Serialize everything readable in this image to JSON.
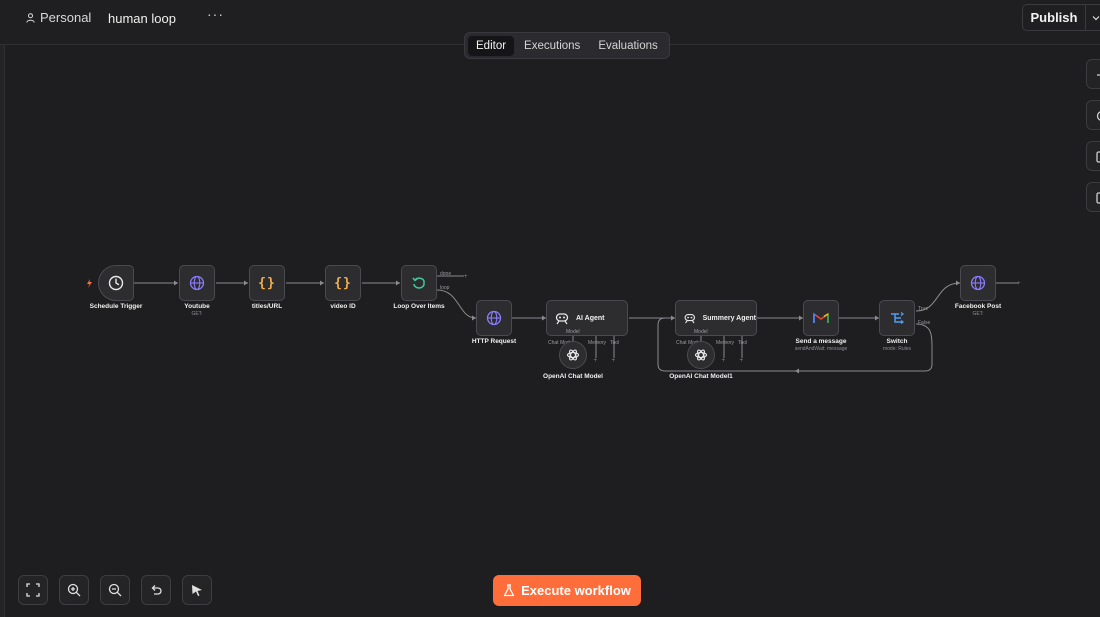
{
  "topbar": {
    "workspace": "Personal",
    "workflow_title": "human loop",
    "more_label": "···",
    "publish_label": "Publish"
  },
  "tabs": [
    {
      "label": "Editor",
      "active": true
    },
    {
      "label": "Executions",
      "active": false
    },
    {
      "label": "Evaluations",
      "active": false
    }
  ],
  "nodes": {
    "schedule_trigger": {
      "label": "Schedule Trigger"
    },
    "youtube": {
      "label": "Youtube",
      "sub": "GET:"
    },
    "titles_url": {
      "label": "titles/URL"
    },
    "video_id": {
      "label": "video ID"
    },
    "loop_over_items": {
      "label": "Loop Over Items",
      "out_done": "done",
      "out_loop": "loop"
    },
    "http_request": {
      "label": "HTTP Request"
    },
    "ai_agent": {
      "label": "AI Agent",
      "ports": {
        "model": "Model",
        "chat": "Chat Model",
        "memory": "Memory",
        "tool": "Tool"
      }
    },
    "openai_model": {
      "label": "OpenAI Chat Model"
    },
    "summery_agent": {
      "label": "Summery Agent",
      "ports": {
        "model": "Model",
        "chat": "Chat Model",
        "memory": "Memory",
        "tool": "Tool"
      }
    },
    "openai_model1": {
      "label": "OpenAI Chat Model1"
    },
    "send_message": {
      "label": "Send a message",
      "sub": "sendAndWait: message"
    },
    "switch": {
      "label": "Switch",
      "sub": "mode: Rules",
      "out_true": "True",
      "out_false": "False"
    },
    "facebook_post": {
      "label": "Facebook Post",
      "sub": "GET:"
    }
  },
  "execute_label": "Execute workflow",
  "colors": {
    "accent": "#ff6d3b",
    "http_icon": "#8b7cff",
    "code_icon": "#f4b04f",
    "loop_icon": "#3fc8a0",
    "switch_icon": "#4f9df0",
    "canvas_bg": "#1e1e20"
  },
  "icons": [
    "person-icon",
    "clock-icon",
    "globe-icon",
    "braces-icon",
    "loop-icon",
    "robot-icon",
    "openai-icon",
    "gmail-icon",
    "switch-icon",
    "fit-view-icon",
    "zoom-in-icon",
    "zoom-out-icon",
    "undo-icon",
    "pointer-icon",
    "flask-icon",
    "chevron-down-icon",
    "plus-icon"
  ]
}
